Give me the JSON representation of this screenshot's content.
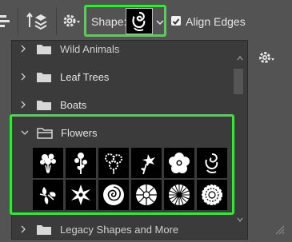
{
  "toolbar": {
    "shape_label": "Shape:",
    "align_edges_label": "Align Edges",
    "align_edges_checked": true
  },
  "panel": {
    "groups": [
      {
        "label": "Wild Animals",
        "expanded": false,
        "partial": true
      },
      {
        "label": "Leaf Trees",
        "expanded": false
      },
      {
        "label": "Boats",
        "expanded": false
      },
      {
        "label": "Flowers",
        "expanded": true
      },
      {
        "label": "Legacy Shapes and More",
        "expanded": false,
        "partial": true
      }
    ],
    "flower_shapes": [
      "flower-bouquet-icon",
      "flower-stem-icon",
      "daisy-cluster-icon",
      "lily-icon",
      "five-petal-flower-icon",
      "swirl-flower-icon",
      "orchid-icon",
      "lotus-icon",
      "rose-icon",
      "round-flower-icon",
      "daisy-icon",
      "chrysanthemum-icon"
    ]
  },
  "colors": {
    "highlight": "#39e53b",
    "panel_bg": "#3b3b3b",
    "toolbar_bg": "#535353"
  }
}
